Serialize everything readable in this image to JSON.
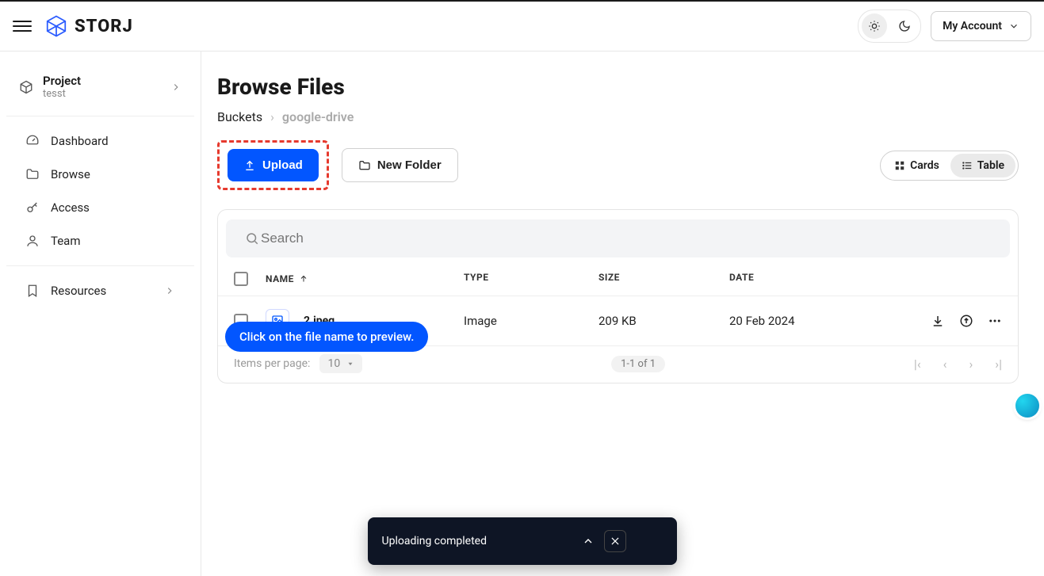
{
  "header": {
    "brand": "STORJ",
    "account_label": "My Account"
  },
  "sidebar": {
    "project": {
      "label": "Project",
      "name": "tesst"
    },
    "nav": {
      "dashboard": "Dashboard",
      "browse": "Browse",
      "access": "Access",
      "team": "Team",
      "resources": "Resources"
    }
  },
  "page": {
    "title": "Browse Files",
    "breadcrumb": {
      "root": "Buckets",
      "current": "google-drive"
    },
    "upload_label": "Upload",
    "new_folder_label": "New Folder",
    "view": {
      "cards": "Cards",
      "table": "Table"
    },
    "search_placeholder": "Search",
    "columns": {
      "name": "NAME",
      "type": "TYPE",
      "size": "SIZE",
      "date": "DATE"
    },
    "rows": [
      {
        "name": "2.jpeg",
        "type": "Image",
        "size": "209 KB",
        "date": "20 Feb 2024"
      }
    ],
    "tooltip": "Click on the file name to preview.",
    "paging": {
      "items_per_page_label": "Items per page:",
      "items_per_page_value": "10",
      "range": "1-1 of 1"
    }
  },
  "toast": {
    "message": "Uploading completed"
  }
}
